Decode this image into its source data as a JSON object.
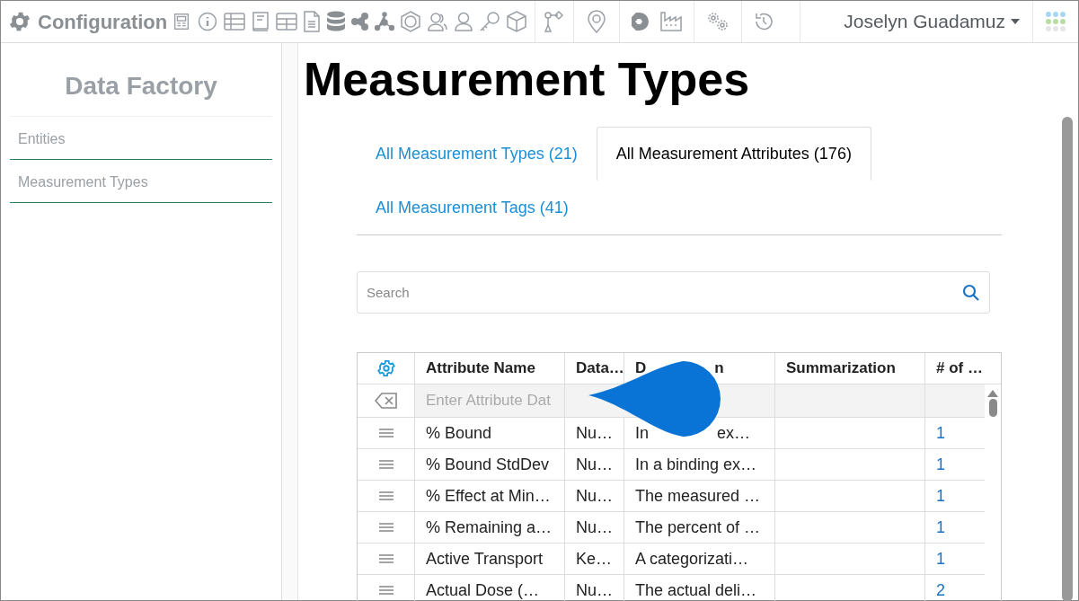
{
  "app": {
    "title": "Configuration",
    "user": "Joselyn Guadamuz"
  },
  "sidebar": {
    "title": "Data Factory",
    "items": [
      {
        "label": "Entities"
      },
      {
        "label": "Measurement Types"
      }
    ]
  },
  "page": {
    "title": "Measurement Types"
  },
  "tabs": [
    {
      "label": "All Measurement Types (21)",
      "selected": false
    },
    {
      "label": "All Measurement Attributes (176)",
      "selected": true
    },
    {
      "label": "All Measurement Tags (41)",
      "selected": false
    }
  ],
  "search": {
    "placeholder": "Search"
  },
  "table": {
    "columns": [
      {
        "label": "Attribute Name"
      },
      {
        "label": "Data…"
      },
      {
        "visible_parts": [
          "D",
          "n"
        ]
      },
      {
        "label": "Summarization"
      },
      {
        "label": "# of …"
      }
    ],
    "filter_placeholder": "Enter Attribute Dat",
    "rows": [
      {
        "name": "% Bound",
        "data_type": "Nu…",
        "description_parts": [
          "In",
          "ex…"
        ],
        "count": "1"
      },
      {
        "name": "% Bound StdDev",
        "data_type": "Nu…",
        "description": "In a binding ex…",
        "count": "1"
      },
      {
        "name": "% Effect at Min…",
        "data_type": "Nu…",
        "description": "The measured …",
        "count": "1"
      },
      {
        "name": "% Remaining a…",
        "data_type": "Nu…",
        "description": "The percent of …",
        "count": "1"
      },
      {
        "name": "Active Transport",
        "data_type": "Ke…",
        "description": "A categorizati…",
        "count": "1"
      },
      {
        "name": "Actual Dose (…",
        "data_type": "Nu…",
        "description": "The actual deli…",
        "count": "2"
      }
    ]
  }
}
